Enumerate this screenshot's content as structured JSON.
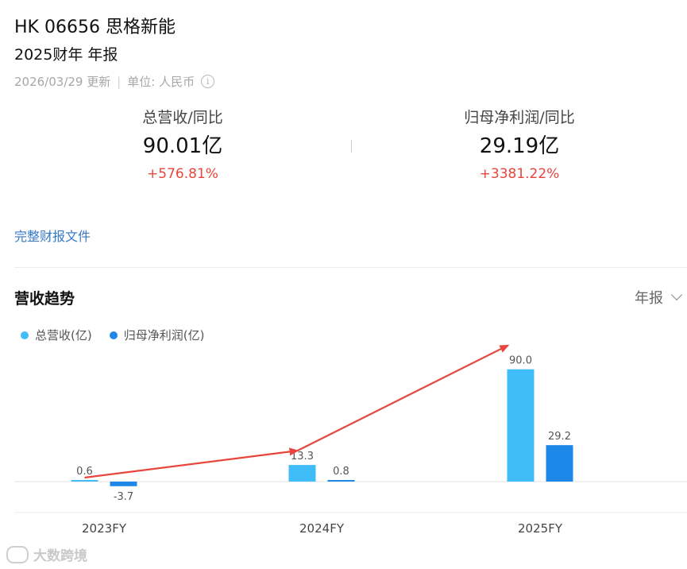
{
  "header": {
    "title": "HK 06656 思格新能",
    "subtitle": "2025财年 年报",
    "updated": "2026/03/29 更新",
    "unit": "单位: 人民币"
  },
  "kpis": [
    {
      "label": "总营收/同比",
      "value": "90.01亿",
      "change": "+576.81%"
    },
    {
      "label": "归母净利润/同比",
      "value": "29.19亿",
      "change": "+3381.22%"
    }
  ],
  "report_link": "完整财报文件",
  "section": {
    "title": "营收趋势",
    "period": "年报"
  },
  "colors": {
    "revenue": "#40bcf9",
    "net_profit": "#1e88e8",
    "arrow": "#e8453c",
    "positive": "#e8453c"
  },
  "chart_data": {
    "type": "bar",
    "categories": [
      "2023FY",
      "2024FY",
      "2025FY"
    ],
    "series": [
      {
        "name": "总营收(亿)",
        "values": [
          0.6,
          13.3,
          90.0
        ],
        "labels": [
          "0.6",
          "13.3",
          "90.0"
        ]
      },
      {
        "name": "归母净利润(亿)",
        "values": [
          -3.7,
          0.8,
          29.2
        ],
        "labels": [
          "-3.7",
          "0.8",
          "29.2"
        ]
      }
    ],
    "legend": "top-left",
    "grid": false
  },
  "watermark": "大数跨境"
}
